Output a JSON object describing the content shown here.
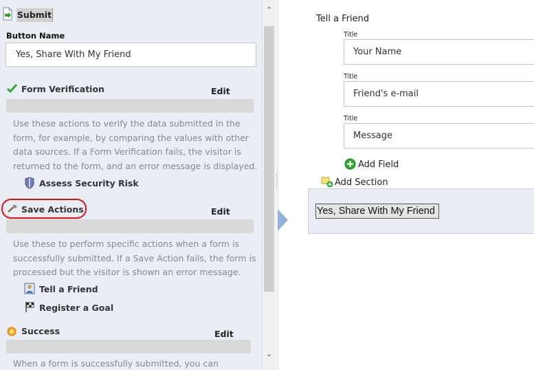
{
  "left": {
    "submit_tab": "Submit",
    "button_name_label": "Button Name",
    "button_name_value": "Yes, Share With My Friend",
    "form_verification": {
      "heading": "Form Verification",
      "edit": "Edit",
      "desc_lines": [
        "Use these actions to verify the data submitted in the",
        "form, for example, by comparing the values with other",
        "data sources. If a Form Verification fails, the visitor is",
        "returned to the form, and an error message is displayed."
      ],
      "items": [
        "Assess Security Risk"
      ]
    },
    "save_actions": {
      "heading": "Save Actions",
      "edit": "Edit",
      "desc_lines": [
        "Use these to perform specific actions when a form is",
        "successfully submitted. If a Save Action fails, the form is",
        "processed but the visitor is shown an error message."
      ],
      "items": [
        "Tell a Friend",
        "Register a Goal"
      ]
    },
    "success": {
      "heading": "Success",
      "edit": "Edit",
      "desc_lines": [
        "When a form is successfully submitted, you can"
      ]
    }
  },
  "right": {
    "form_title": "Tell a Friend",
    "fields": [
      {
        "title": "Title",
        "value": "Your Name"
      },
      {
        "title": "Title",
        "value": "Friend's e-mail"
      },
      {
        "title": "Title",
        "value": "Message"
      }
    ],
    "add_field": "Add Field",
    "add_section": "Add Section",
    "preview_button": "Yes, Share With My Friend"
  },
  "colors": {
    "panel_bg": "#eaedf3",
    "highlight": "#e01010",
    "arrow": "#8fb4db",
    "add_green": "#2fa82f"
  }
}
